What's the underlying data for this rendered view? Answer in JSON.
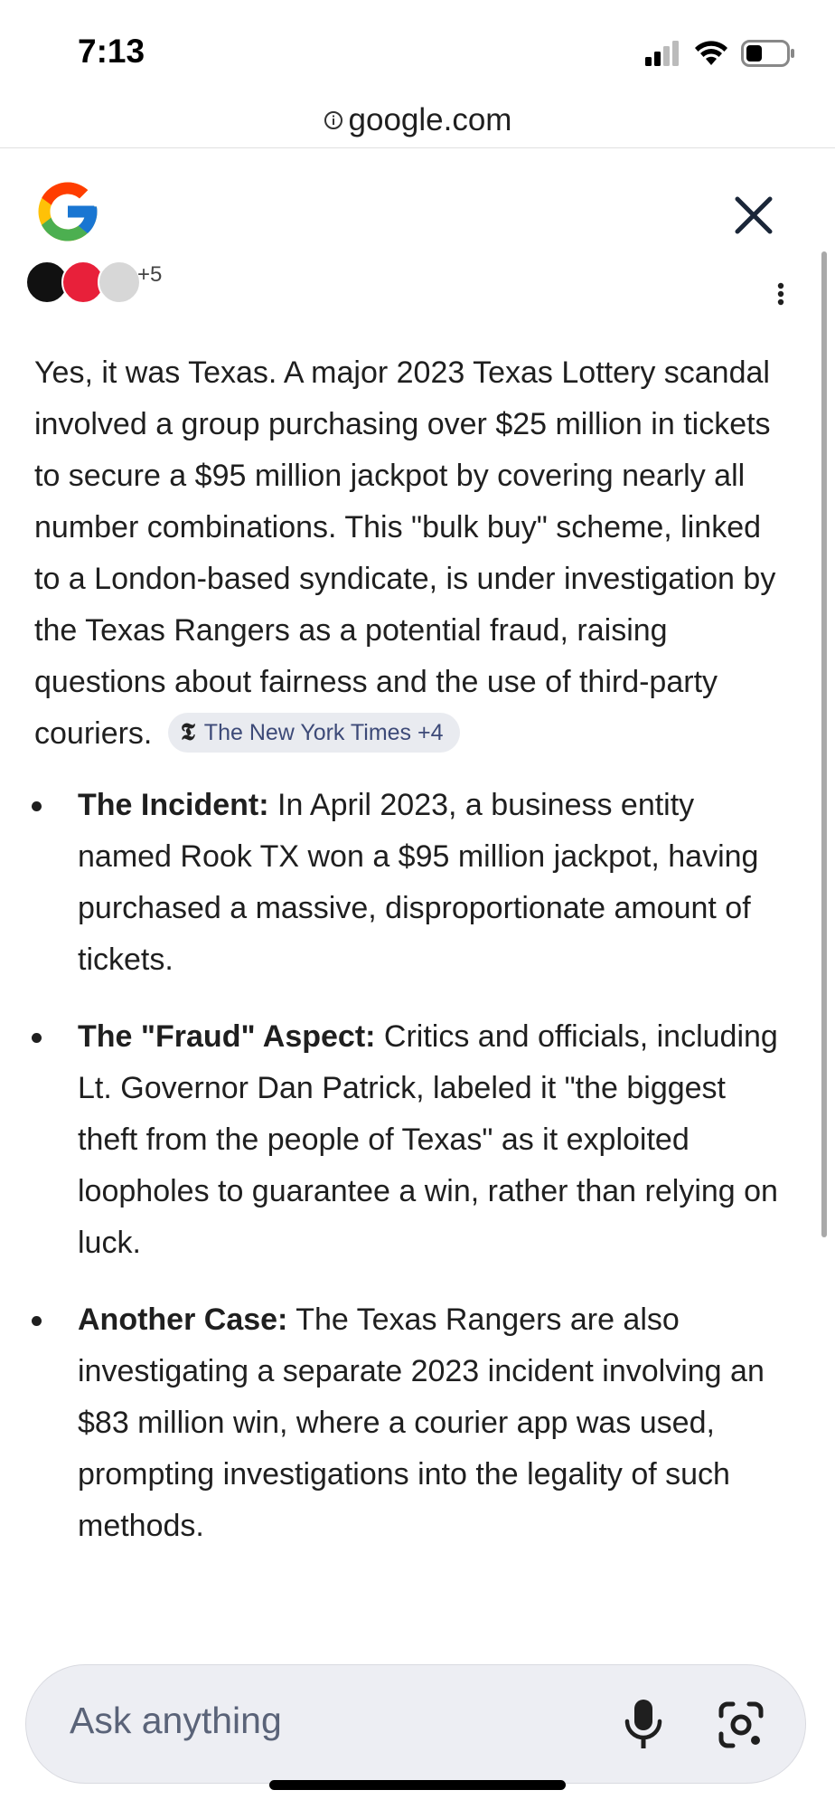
{
  "status_bar": {
    "time": "7:13",
    "icons": [
      "cellular-signal-icon",
      "wifi-icon",
      "battery-icon"
    ]
  },
  "browser": {
    "url": "google.com",
    "url_icon": "info-icon"
  },
  "header": {
    "logo": "google-g-logo",
    "close_icon": "close-icon"
  },
  "sources": {
    "more_count": "+5",
    "menu_icon": "more-vert-icon"
  },
  "answer": {
    "intro": "Yes, it was Texas. A major 2023 Texas Lottery scandal involved a group purchasing over $25 million in tickets to secure a $95 million jackpot by covering nearly all number combinations. This \"bulk buy\" scheme, linked to a London-based syndicate, is under investigation by the Texas Rangers as a potential fraud, raising questions about fairness and the use of third-party couriers.",
    "citation": {
      "logo": "𝕿",
      "label": "The New York Times +4"
    },
    "bullets": [
      {
        "title": "The Incident:",
        "text": " In April 2023, a business entity named Rook TX won a $95 million jackpot, having purchased a massive, disproportionate amount of tickets."
      },
      {
        "title": "The \"Fraud\" Aspect:",
        "text": " Critics and officials, including Lt. Governor Dan Patrick, labeled it \"the biggest theft from the people of Texas\" as it exploited loopholes to guarantee a win, rather than relying on luck."
      },
      {
        "title": "Another Case:",
        "text": " The Texas Rangers are also investigating a separate 2023 incident involving an $83 million win, where a courier app was used, prompting investigations into the legality of such methods."
      }
    ]
  },
  "input": {
    "placeholder": "Ask anything",
    "mic_icon": "mic-icon",
    "lens_icon": "google-lens-icon"
  },
  "colors": {
    "chip_bg": "#e9ebf0",
    "chip_text": "#3d4a78",
    "input_bg": "#edeef3"
  }
}
